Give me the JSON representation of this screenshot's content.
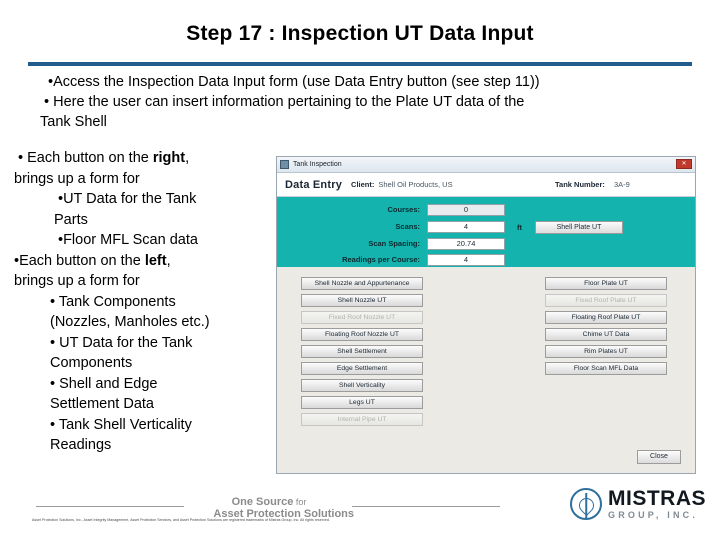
{
  "slide": {
    "title": "Step 17 : Inspection UT Data Input",
    "accent_color": "#1f5c8b"
  },
  "top_bullets": {
    "line1": "•Access the Inspection Data Input form (use Data Entry button (see step 11))",
    "line2": "• Here the user can insert information pertaining to the Plate UT data of the",
    "line3": "Tank Shell"
  },
  "left_column": {
    "b1_pre": "• Each button on the ",
    "b1_bold": "right",
    "b1_post": ",",
    "b1_cont": "brings up a form for",
    "b1_sub1": "•UT Data for the Tank",
    "b1_sub1_cont": "Parts",
    "b1_sub2": "•Floor MFL  Scan data",
    "b2_pre": "•Each button on the ",
    "b2_bold": "left",
    "b2_post": ",",
    "b2_cont": "brings up a form for",
    "b2_sub1": "•  Tank Components",
    "b2_sub1_cont": "(Nozzles, Manholes etc.)",
    "b2_sub2": "•  UT Data for the Tank",
    "b2_sub2_cont": "Components",
    "b2_sub3": "•  Shell and Edge",
    "b2_sub3_cont": "Settlement Data",
    "b2_sub4": "•  Tank Shell Verticality",
    "b2_sub4_cont": "Readings"
  },
  "app": {
    "window_title": "Tank Inspection",
    "close_glyph": "✕",
    "header": {
      "form_title": "Data Entry",
      "client_label": "Client:",
      "client_value": "Shell Oil Products, US",
      "tank_label": "Tank Number:",
      "tank_value": "3A-9"
    },
    "teal_panel": {
      "fields": [
        {
          "label": "Courses:",
          "value": "0",
          "readonly": true
        },
        {
          "label": "Scans:",
          "value": "4",
          "readonly": false
        },
        {
          "label": "Scan Spacing:",
          "value": "20.74",
          "readonly": false
        },
        {
          "label": "Readings per Course:",
          "value": "4",
          "readonly": false
        }
      ],
      "unit_label": "ft",
      "shell_plate_button": "Shell Plate UT",
      "background_color": "#14b3ad"
    },
    "left_buttons": [
      {
        "label": "Shell Nozzle and Appurtenance",
        "disabled": false
      },
      {
        "label": "Shell Nozzle UT",
        "disabled": false
      },
      {
        "label": "Fixed Roof Nozzle UT",
        "disabled": true
      },
      {
        "label": "Floating Roof Nozzle UT",
        "disabled": false
      },
      {
        "label": "Shell Settlement",
        "disabled": false
      },
      {
        "label": "Edge Settlement",
        "disabled": false
      },
      {
        "label": "Shell Verticality",
        "disabled": false
      },
      {
        "label": "Legs UT",
        "disabled": false
      },
      {
        "label": "Internal Pipe UT",
        "disabled": true
      }
    ],
    "right_buttons": [
      {
        "label": "Floor Plate UT",
        "disabled": false
      },
      {
        "label": "Fixed Roof Plate UT",
        "disabled": true
      },
      {
        "label": "Floating Roof Plate UT",
        "disabled": false
      },
      {
        "label": "Chime UT Data",
        "disabled": false
      },
      {
        "label": "Rim Plates UT",
        "disabled": false
      },
      {
        "label": "Floor Scan MFL  Data",
        "disabled": false
      }
    ],
    "close_button": "Close"
  },
  "footer": {
    "tagline_line1": "One Source",
    "tagline_for": " for",
    "tagline_line2": "Asset Protection Solutions",
    "fineprint": "Asset Protection Solutions, Inc., Asset Integrity Management, Asset Protection Services, and Asset Protection Solutions are registered trademarks of Mistras Group, Inc. All rights reserved.",
    "logo_name": "MISTRAS",
    "logo_sub": "GROUP, INC.",
    "logo_color": "#2f6f9e"
  }
}
